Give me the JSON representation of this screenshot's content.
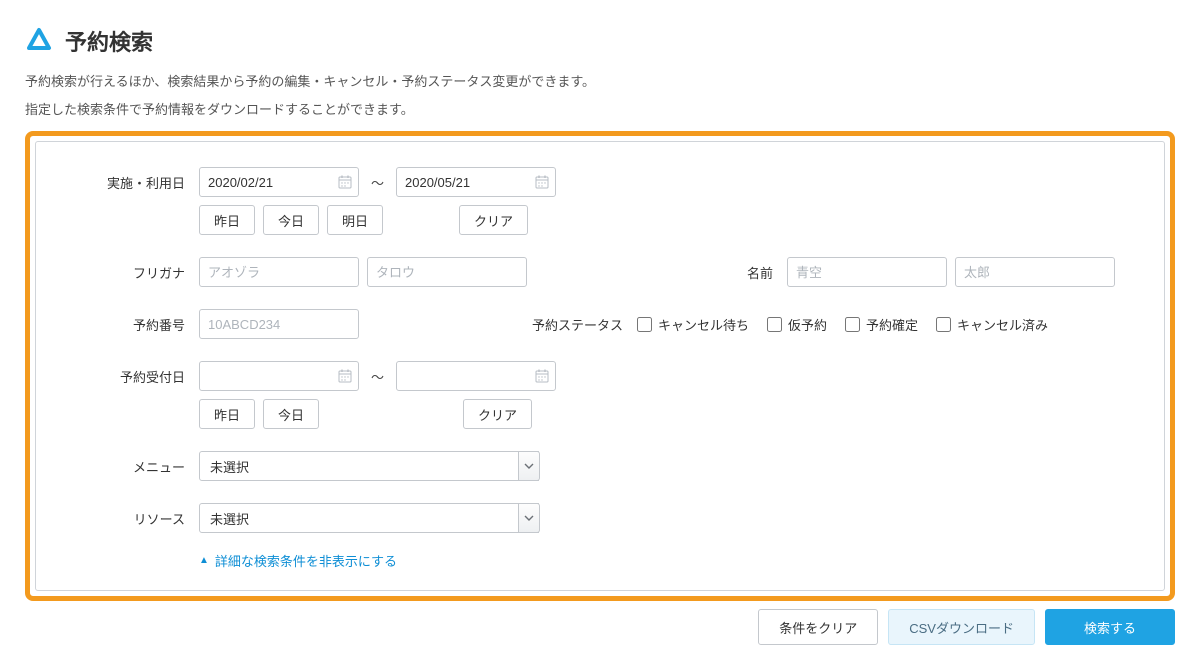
{
  "header": {
    "title": "予約検索",
    "desc1": "予約検索が行えるほか、検索結果から予約の編集・キャンセル・予約ステータス変更ができます。",
    "desc2": "指定した検索条件で予約情報をダウンロードすることができます。"
  },
  "form": {
    "date_label": "実施・利用日",
    "date_from": "2020/02/21",
    "date_to": "2020/05/21",
    "tilde": "〜",
    "btn_yesterday": "昨日",
    "btn_today": "今日",
    "btn_tomorrow": "明日",
    "btn_clear": "クリア",
    "furigana_label": "フリガナ",
    "furigana_last_ph": "アオゾラ",
    "furigana_first_ph": "タロウ",
    "name_label": "名前",
    "name_last_ph": "青空",
    "name_first_ph": "太郎",
    "resnum_label": "予約番号",
    "resnum_ph": "10ABCD234",
    "status_label": "予約ステータス",
    "status_opts": {
      "waitlist": "キャンセル待ち",
      "tentative": "仮予約",
      "confirmed": "予約確定",
      "cancelled": "キャンセル済み"
    },
    "recvdate_label": "予約受付日",
    "menu_label": "メニュー",
    "menu_value": "未選択",
    "resource_label": "リソース",
    "resource_value": "未選択",
    "toggle_link": "詳細な検索条件を非表示にする"
  },
  "footer": {
    "clear": "条件をクリア",
    "csv": "CSVダウンロード",
    "search": "検索する"
  }
}
